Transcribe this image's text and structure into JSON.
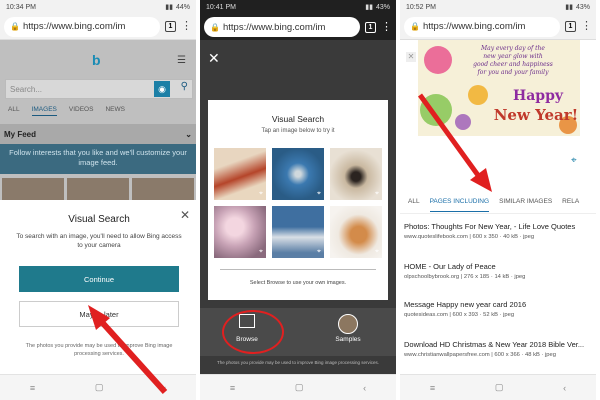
{
  "panel1": {
    "status_time": "10:34 PM",
    "status_battery": "44%",
    "url": "https://www.bing.com/im",
    "tab_count": "1",
    "search_placeholder": "Search...",
    "tabs": [
      "ALL",
      "IMAGES",
      "VIDEOS",
      "NEWS"
    ],
    "feed_label": "My Feed",
    "feed_message": "Follow interests that you like and we'll customize your image feed.",
    "dialog": {
      "title": "Visual Search",
      "message": "To search with an image, you'll need to allow Bing access to your camera",
      "continue_label": "Continue",
      "later_label": "Maybe later",
      "footer": "The photos you provide may be used to improve Bing image processing services."
    }
  },
  "panel2": {
    "status_time": "10:41 PM",
    "status_battery": "43%",
    "url": "https://www.bing.com/im",
    "tab_count": "1",
    "card_title": "Visual Search",
    "card_subtitle": "Tap an image below to try it",
    "card_hint": "Select Browse to use your own images.",
    "browse_label": "Browse",
    "samples_label": "Samples",
    "footer": "The photos you provide may be used to improve Bing image processing services."
  },
  "panel3": {
    "status_time": "10:52 PM",
    "status_battery": "43%",
    "url": "https://www.bing.com/im",
    "tab_count": "1",
    "card_text": "May every day of the new year glow with good cheer and happiness for you and your family",
    "card_big1": "Happy",
    "card_big2": "New Year!",
    "tabs": [
      "ALL",
      "PAGES INCLUDING",
      "SIMILAR IMAGES",
      "RELA"
    ],
    "results": [
      {
        "title": "Photos: Thoughts For New Year, - Life Love Quotes",
        "meta": "www.quoteslifebook.com | 600 x 350 · 40 kB · jpeg"
      },
      {
        "title": "HOME - Our Lady of Peace",
        "meta": "olpschoolbybrook.org | 276 x 185 · 14 kB · jpeg"
      },
      {
        "title": "Message Happy new year card 2016",
        "meta": "quotesideas.com | 600 x 393 · 52 kB · jpeg"
      },
      {
        "title": "Download HD Christmas & New Year 2018 Bible Ver...",
        "meta": "www.christianwallpapersfree.com | 600 x 366 · 48 kB · jpeg"
      }
    ]
  },
  "colors": {
    "accent": "#1f7a8c",
    "annotation": "#e02020"
  }
}
